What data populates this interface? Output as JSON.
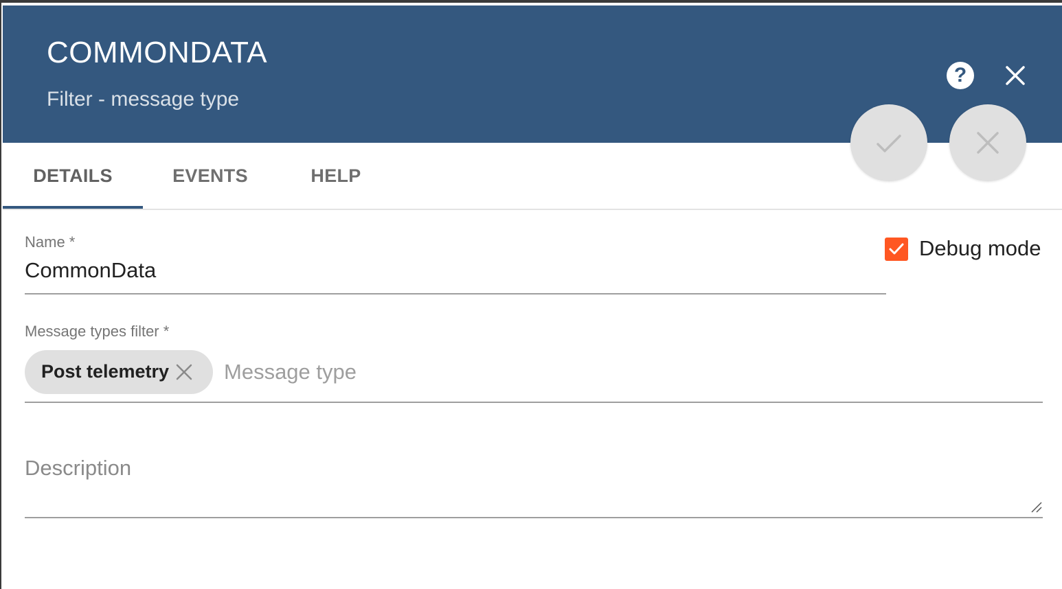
{
  "header": {
    "title": "COMMONDATA",
    "subtitle": "Filter - message type",
    "background_color": "#34587f",
    "help_label": "?",
    "icons": {
      "help": "help-circle-icon",
      "close": "close-icon"
    }
  },
  "actions": {
    "apply_icon": "check-icon",
    "discard_icon": "close-icon"
  },
  "tabs": [
    {
      "label": "DETAILS",
      "active": true
    },
    {
      "label": "EVENTS",
      "active": false
    },
    {
      "label": "HELP",
      "active": false
    }
  ],
  "form": {
    "name": {
      "label": "Name *",
      "value": "CommonData"
    },
    "debug_mode": {
      "label": "Debug mode",
      "checked": true,
      "color": "#ff5722"
    },
    "message_types": {
      "label": "Message types filter *",
      "chips": [
        {
          "label": "Post telemetry"
        }
      ],
      "input_placeholder": "Message type"
    },
    "description": {
      "placeholder": "Description",
      "value": ""
    }
  }
}
